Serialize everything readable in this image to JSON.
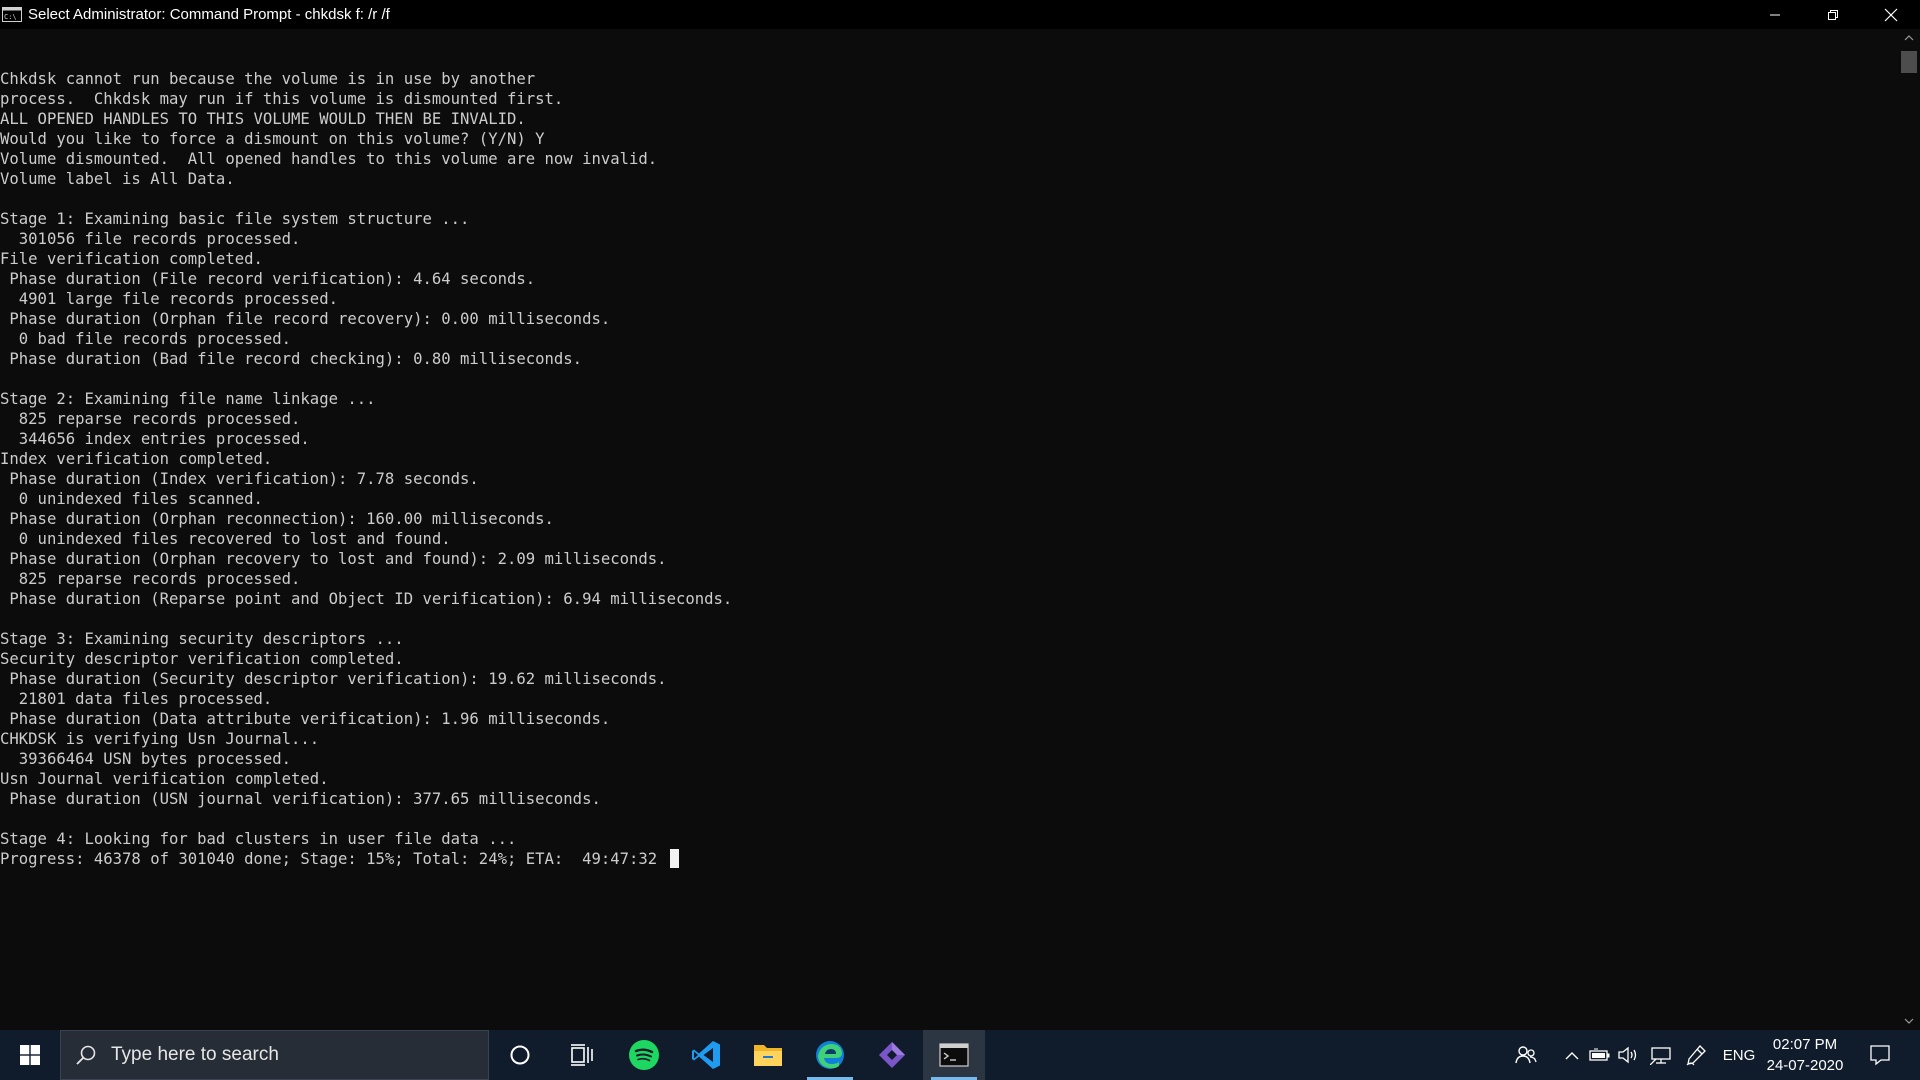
{
  "window": {
    "title": "Select Administrator: Command Prompt - chkdsk  f: /r /f",
    "icon": "cmd-icon"
  },
  "console": {
    "lines": [
      "",
      "Chkdsk cannot run because the volume is in use by another",
      "process.  Chkdsk may run if this volume is dismounted first.",
      "ALL OPENED HANDLES TO THIS VOLUME WOULD THEN BE INVALID.",
      "Would you like to force a dismount on this volume? (Y/N) Y",
      "Volume dismounted.  All opened handles to this volume are now invalid.",
      "Volume label is All Data.",
      "",
      "Stage 1: Examining basic file system structure ...",
      "  301056 file records processed.",
      "File verification completed.",
      " Phase duration (File record verification): 4.64 seconds.",
      "  4901 large file records processed.",
      " Phase duration (Orphan file record recovery): 0.00 milliseconds.",
      "  0 bad file records processed.",
      " Phase duration (Bad file record checking): 0.80 milliseconds.",
      "",
      "Stage 2: Examining file name linkage ...",
      "  825 reparse records processed.",
      "  344656 index entries processed.",
      "Index verification completed.",
      " Phase duration (Index verification): 7.78 seconds.",
      "  0 unindexed files scanned.",
      " Phase duration (Orphan reconnection): 160.00 milliseconds.",
      "  0 unindexed files recovered to lost and found.",
      " Phase duration (Orphan recovery to lost and found): 2.09 milliseconds.",
      "  825 reparse records processed.",
      " Phase duration (Reparse point and Object ID verification): 6.94 milliseconds.",
      "",
      "Stage 3: Examining security descriptors ...",
      "Security descriptor verification completed.",
      " Phase duration (Security descriptor verification): 19.62 milliseconds.",
      "  21801 data files processed.",
      " Phase duration (Data attribute verification): 1.96 milliseconds.",
      "CHKDSK is verifying Usn Journal...",
      "  39366464 USN bytes processed.",
      "Usn Journal verification completed.",
      " Phase duration (USN journal verification): 377.65 milliseconds.",
      "",
      "Stage 4: Looking for bad clusters in user file data ...",
      "Progress: 46378 of 301040 done; Stage: 15%; Total: 24%; ETA:  49:47:32"
    ]
  },
  "taskbar": {
    "search_placeholder": "Type here to search",
    "pinned": [
      "cortana-icon",
      "task-view-icon",
      "spotify-icon",
      "vscode-icon",
      "file-explorer-icon",
      "edge-icon",
      "visual-studio-icon",
      "command-prompt-icon"
    ],
    "tray": {
      "language": "ENG",
      "time": "02:07 PM",
      "date": "24-07-2020"
    }
  },
  "colors": {
    "console_bg": "#0c0c0c",
    "console_fg": "#cccccc",
    "taskbar_bg": "#101c2c",
    "active_indicator": "#76b9ed"
  }
}
